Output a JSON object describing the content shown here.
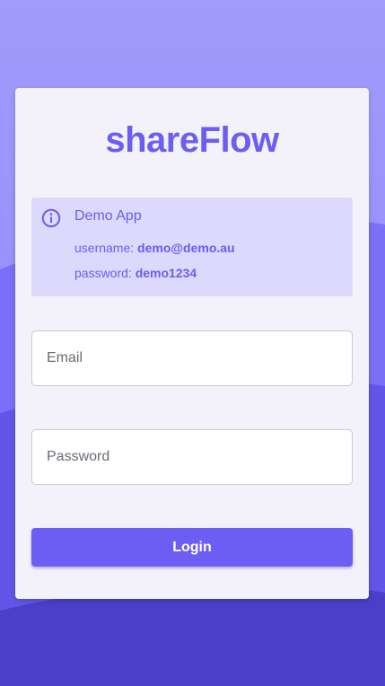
{
  "app": {
    "brand": "shareFlow"
  },
  "demo_notice": {
    "icon": "info-icon",
    "title": "Demo App",
    "username_label": "username:",
    "username_value": "demo@demo.au",
    "password_label": "password:",
    "password_value": "demo1234"
  },
  "form": {
    "email_placeholder": "Email",
    "email_value": "",
    "password_placeholder": "Password",
    "password_value": "",
    "login_label": "Login"
  },
  "colors": {
    "accent": "#6c5ef2",
    "notice_bg": "#dcd9fd",
    "card_bg": "#f3f2fb",
    "bg_top": "#9d96fb",
    "bg_bottom": "#4a3fc8"
  }
}
